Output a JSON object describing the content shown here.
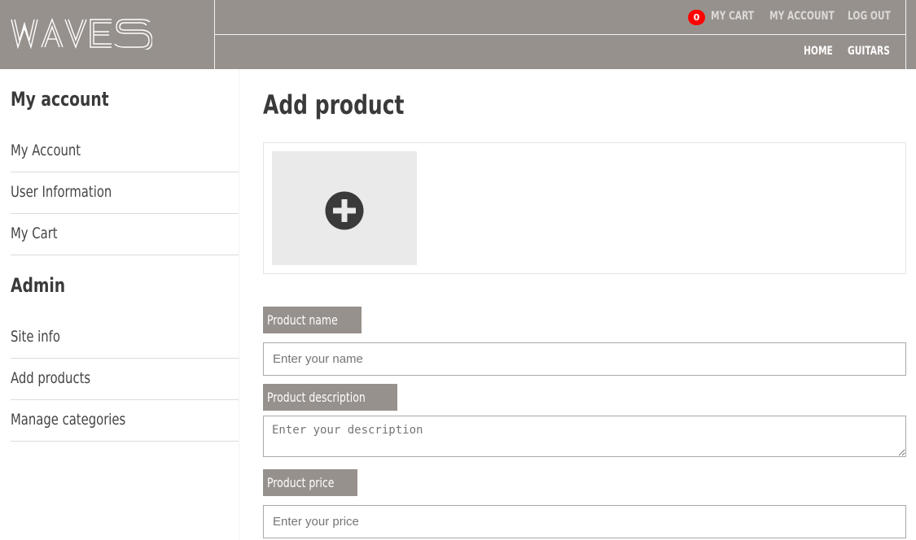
{
  "header": {
    "logo": "WAVES",
    "cart_count": "0",
    "top_links": [
      {
        "label": "MY CART"
      },
      {
        "label": "MY ACCOUNT"
      },
      {
        "label": "LOG OUT"
      }
    ],
    "main_links": [
      {
        "label": "HOME"
      },
      {
        "label": "GUITARS"
      }
    ]
  },
  "sidebar": {
    "account_heading": "My account",
    "account_items": [
      {
        "label": "My Account"
      },
      {
        "label": "User Information"
      },
      {
        "label": "My Cart"
      }
    ],
    "admin_heading": "Admin",
    "admin_items": [
      {
        "label": "Site info"
      },
      {
        "label": "Add products"
      },
      {
        "label": "Manage categories"
      }
    ]
  },
  "main": {
    "title": "Add product",
    "upload_icon": "plus-circle-icon",
    "fields": {
      "name": {
        "label": "Product name",
        "placeholder": "Enter your name",
        "value": ""
      },
      "description": {
        "label": "Product description",
        "placeholder": "Enter your description",
        "value": ""
      },
      "price": {
        "label": "Product price",
        "placeholder": "Enter your price",
        "value": ""
      }
    }
  },
  "colors": {
    "header_bg": "#97918d",
    "cart_badge": "#ff0000",
    "upload_bg": "#eaeaea",
    "text_dark": "#3a3a3a"
  }
}
